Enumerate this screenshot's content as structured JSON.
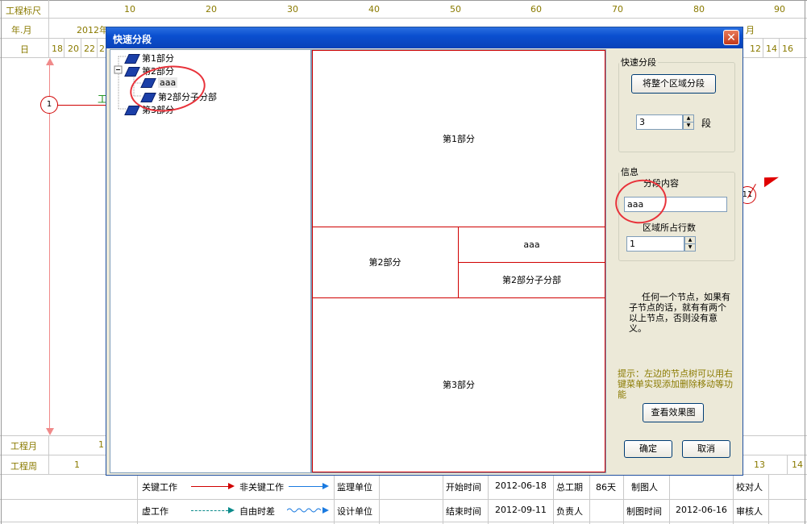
{
  "header": {
    "row1_label": "工程标尺",
    "row2_label": "年.月",
    "row3_label": "日",
    "scale_ticks": [
      "10",
      "20",
      "30",
      "40",
      "50",
      "60",
      "70",
      "80",
      "90"
    ],
    "year_month_left": "2012年",
    "year_month_right": "月",
    "day_numbers_left": [
      "18",
      "20",
      "22",
      "2"
    ],
    "day_numbers_right": [
      "12",
      "14",
      "16"
    ]
  },
  "canvas": {
    "node_1": "1",
    "node_11": "11",
    "partial_label": "工"
  },
  "footer": {
    "row1_label": "工程月",
    "row1_value": "1",
    "row2_label": "工程周",
    "row2_value": "1",
    "row2_value_right": "13",
    "row2_value_right2": "14"
  },
  "legend": {
    "key_work": "关键工作",
    "non_key_work": "非关键工作",
    "virtual_work": "虚工作",
    "free_float": "自由时差",
    "supervisor": "监理单位",
    "design_unit": "设计单位",
    "start_time_label": "开始时间",
    "start_time": "2012-06-18",
    "end_time_label": "结束时间",
    "end_time": "2012-09-11",
    "total_duration_label": "总工期",
    "total_duration": "86天",
    "responsible_label": "负责人",
    "drawer_label": "制图人",
    "draw_time_label": "制图时间",
    "draw_time": "2012-06-16",
    "checker_label": "校对人",
    "reviewer_label": "审核人"
  },
  "dialog": {
    "title": "快速分段",
    "close_symbol": "✕",
    "tree": {
      "items": [
        {
          "label": "第1部分",
          "level": 0
        },
        {
          "label": "第2部分",
          "level": 0,
          "expander": "−"
        },
        {
          "label": "aaa",
          "level": 1
        },
        {
          "label": "第2部分子分部",
          "level": 1
        },
        {
          "label": "第3部分",
          "level": 0
        }
      ]
    },
    "preview": {
      "part1": "第1部分",
      "part2": "第2部分",
      "aaa": "aaa",
      "part2_sub": "第2部分子分部",
      "part3": "第3部分"
    },
    "quick_split": {
      "legend": "快速分段",
      "split_all_button": "将整个区域分段",
      "segments_value": "3",
      "segments_unit": "段"
    },
    "info": {
      "legend": "信息",
      "content_label": "分段内容",
      "content_value": "aaa",
      "rows_label": "区域所占行数",
      "rows_value": "1"
    },
    "note": "任何一个节点，如果有子节点的话，就有有两个以上节点，否则没有意义。",
    "hint": "提示：左边的节点树可以用右键菜单实现添加删除移动等功能",
    "view_effect_button": "查看效果图",
    "ok_button": "确定",
    "cancel_button": "取消"
  }
}
